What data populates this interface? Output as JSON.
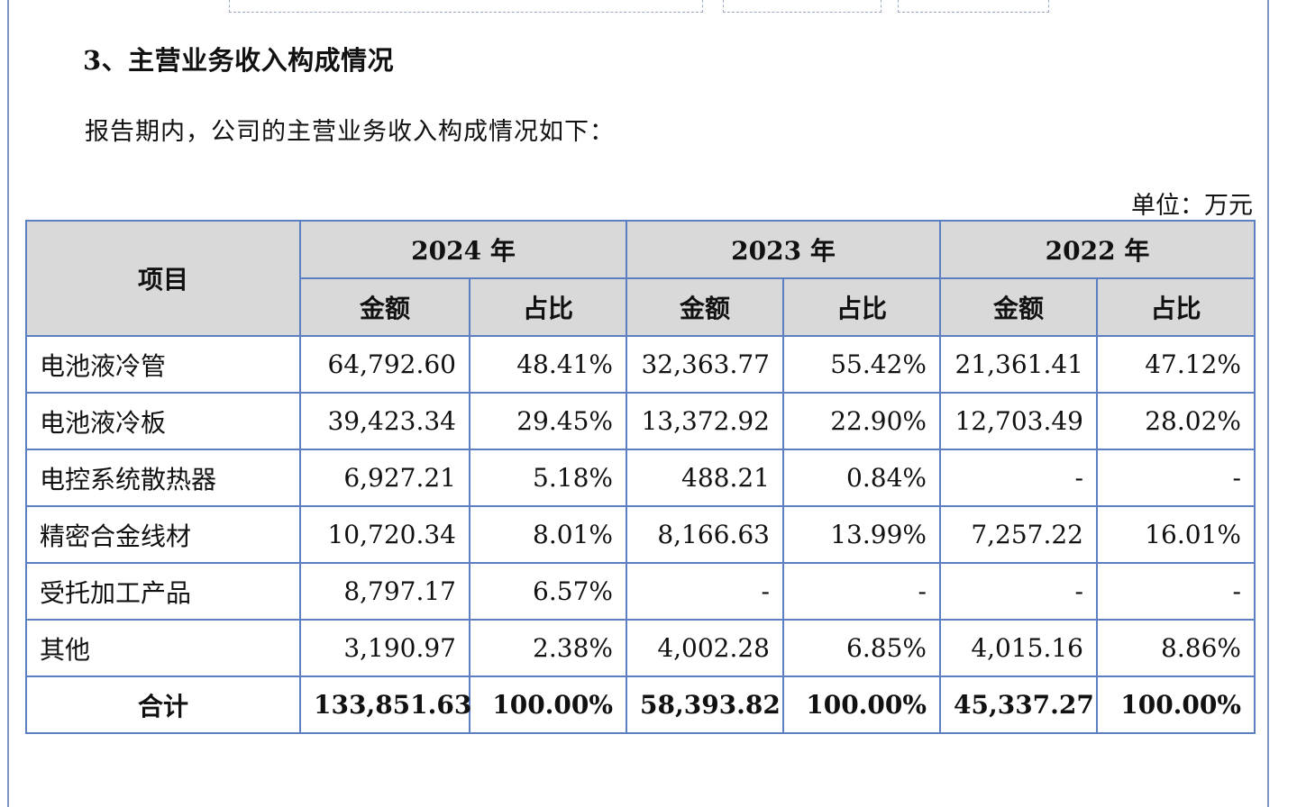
{
  "section_title": "3、主营业务收入构成情况",
  "intro": "报告期内，公司的主营业务收入构成情况如下：",
  "unit": "单位：万元",
  "table": {
    "item_header": "项目",
    "years": [
      "2024 年",
      "2023 年",
      "2022 年"
    ],
    "sub_headers": [
      "金额",
      "占比"
    ],
    "rows": [
      {
        "name": "电池液冷管",
        "cells": [
          "64,792.60",
          "48.41%",
          "32,363.77",
          "55.42%",
          "21,361.41",
          "47.12%"
        ]
      },
      {
        "name": "电池液冷板",
        "cells": [
          "39,423.34",
          "29.45%",
          "13,372.92",
          "22.90%",
          "12,703.49",
          "28.02%"
        ]
      },
      {
        "name": "电控系统散热器",
        "cells": [
          "6,927.21",
          "5.18%",
          "488.21",
          "0.84%",
          "-",
          "-"
        ]
      },
      {
        "name": "精密合金线材",
        "cells": [
          "10,720.34",
          "8.01%",
          "8,166.63",
          "13.99%",
          "7,257.22",
          "16.01%"
        ]
      },
      {
        "name": "受托加工产品",
        "cells": [
          "8,797.17",
          "6.57%",
          "-",
          "-",
          "-",
          "-"
        ]
      },
      {
        "name": "其他",
        "cells": [
          "3,190.97",
          "2.38%",
          "4,002.28",
          "6.85%",
          "4,015.16",
          "8.86%"
        ]
      }
    ],
    "total": {
      "name": "合计",
      "cells": [
        "133,851.63",
        "100.00%",
        "58,393.82",
        "100.00%",
        "45,337.27",
        "100.00%"
      ]
    }
  }
}
